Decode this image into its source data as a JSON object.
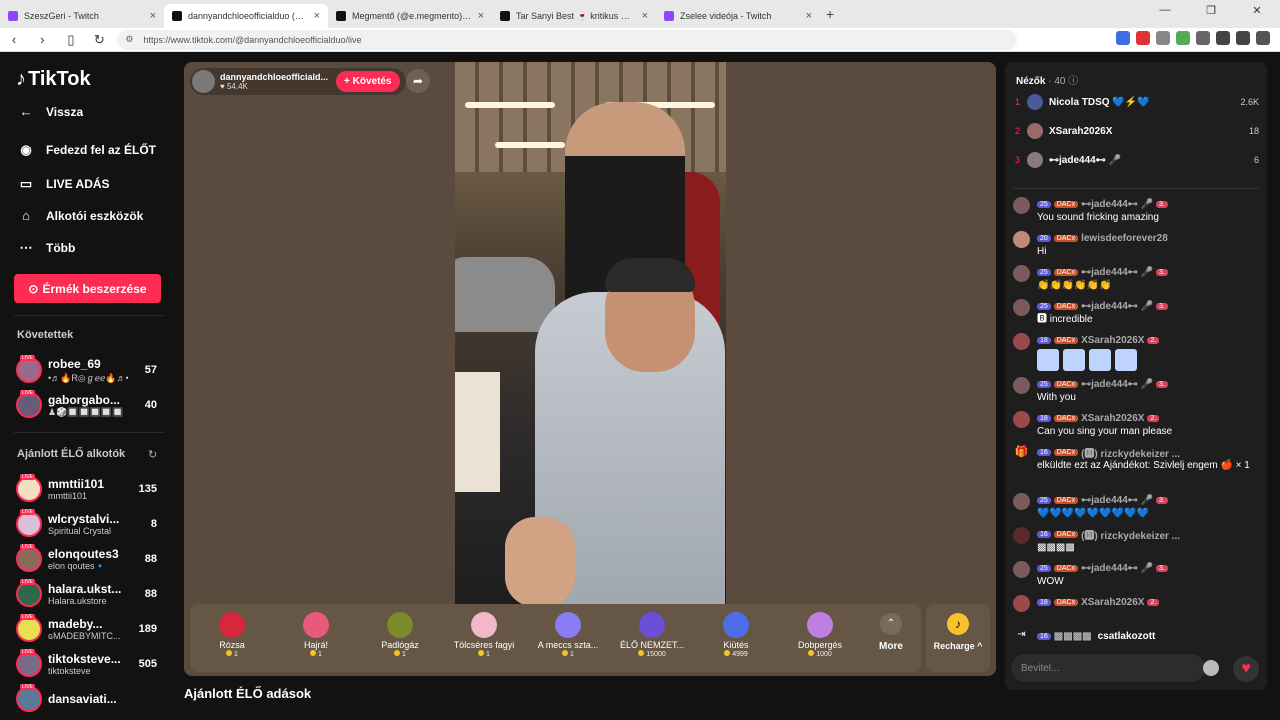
{
  "browser": {
    "tabs": [
      {
        "title": "SzeszGeri - Twitch",
        "color": "#9146ff"
      },
      {
        "title": "dannyandchloeofficialduo (@da…",
        "color": "#111111"
      },
      {
        "title": "Megmentő (@e.megmento) ÉLŐ adá…",
        "color": "#111111"
      },
      {
        "title": "Tar Sanyi Best 🍷 kritikus 🎒 (@szop…",
        "color": "#111111"
      },
      {
        "title": "Zselee videója - Twitch",
        "color": "#9146ff"
      }
    ],
    "url": "https://www.tiktok.com/@dannyandchloeofficialduo/live"
  },
  "sidebar": {
    "logo": "TikTok",
    "nav": [
      {
        "label": "Vissza",
        "icon": "back-arrow-icon",
        "glyph": "←"
      },
      {
        "label": "Fedezd fel az ÉLŐT",
        "icon": "explore-live-icon",
        "glyph": "◉"
      },
      {
        "label": "LIVE ADÁS",
        "icon": "live-camera-icon",
        "glyph": "▭"
      },
      {
        "label": "Alkotói eszközök",
        "icon": "creator-tools-icon",
        "glyph": "⌂"
      },
      {
        "label": "Több",
        "icon": "more-dots-icon",
        "glyph": "⋯"
      }
    ],
    "coins_button": "Érmék beszerzése",
    "following_title": "Követettek",
    "following": [
      {
        "name": "robee_69",
        "sub": "•♬🔥R◎ℊℯℯ🔥♬•",
        "count": "57"
      },
      {
        "name": "gaborgabo...",
        "sub": "♟🎲🔲🔲🔲🔲🔲",
        "count": "40"
      }
    ],
    "suggested_title": "Ajánlott ÉLŐ alkotók",
    "suggested": [
      {
        "name": "mmttii101",
        "sub": "mmttii101",
        "count": "135"
      },
      {
        "name": "wlcrystalvi...",
        "sub": "Spiritual Crystal",
        "count": "8"
      },
      {
        "name": "elonqoutes3",
        "sub": "elon qoutes🔹",
        "count": "88"
      },
      {
        "name": "halara.ukst...",
        "sub": "Halara.ukstore",
        "count": "88"
      },
      {
        "name": "madeby...",
        "sub": "ɢMADEBYMITC...",
        "count": "189"
      },
      {
        "name": "tiktoksteve...",
        "sub": "tiktoksteve",
        "count": "505"
      },
      {
        "name": "dansaviati...",
        "sub": "",
        "count": ""
      }
    ]
  },
  "stream": {
    "host_name": "dannyandchloeofficiald...",
    "likes": "♥ 54.4K",
    "follow_label": "+ Követés",
    "gifts": [
      {
        "name": "Rózsa",
        "price": "1",
        "color": "#d8263a"
      },
      {
        "name": "Hajrá!",
        "price": "1",
        "color": "#e85a7b"
      },
      {
        "name": "Padlógáz",
        "price": "1",
        "color": "#7b8b2a"
      },
      {
        "name": "Tölcséres fagyi",
        "price": "1",
        "color": "#f2b8c8"
      },
      {
        "name": "A meccs szta...",
        "price": "1",
        "color": "#8a7cf5"
      },
      {
        "name": "ÉLŐ NEMZET...",
        "price": "15000",
        "color": "#6b4fd6"
      },
      {
        "name": "Kiütés",
        "price": "4999",
        "color": "#4d6ee8"
      },
      {
        "name": "Dobpergés",
        "price": "1000",
        "color": "#c07ee0"
      }
    ],
    "more_label": "More",
    "recharge_label": "Recharge ^",
    "recommended_title": "Ajánlott ÉLŐ adások"
  },
  "chat": {
    "viewers_label": "Nézők",
    "viewers_count": "· 40",
    "top_viewers": [
      {
        "rank": "1",
        "name": "Nicola TDSQ 💙⚡💙",
        "count": "2.6K"
      },
      {
        "rank": "2",
        "name": "XSarah2026X",
        "count": "18"
      },
      {
        "rank": "3",
        "name": "⊷jade444⊷ 🎤",
        "count": "6"
      }
    ],
    "messages": [
      {
        "lvl": "25",
        "badge": "DACx",
        "user": "⊷jade444⊷ 🎤",
        "rank": "3.",
        "text": "You sound fricking amazing"
      },
      {
        "lvl": "20",
        "badge": "DACx",
        "user": "lewisdeeforever28",
        "rank": "",
        "text": "Hi"
      },
      {
        "lvl": "25",
        "badge": "DACx",
        "user": "⊷jade444⊷ 🎤",
        "rank": "3.",
        "text": "👏👏👏👏👏👏"
      },
      {
        "lvl": "25",
        "badge": "DACx",
        "user": "⊷jade444⊷ 🎤",
        "rank": "3.",
        "text": "🅱 incredible"
      },
      {
        "lvl": "18",
        "badge": "DACx",
        "user": "XSarah2026X",
        "rank": "2.",
        "text": ""
      },
      {
        "lvl": "25",
        "badge": "DACx",
        "user": "⊷jade444⊷ 🎤",
        "rank": "3.",
        "text": "With you"
      },
      {
        "lvl": "18",
        "badge": "DACx",
        "user": "XSarah2026X",
        "rank": "2.",
        "text": "Can you sing your man please"
      },
      {
        "lvl": "16",
        "badge": "DACx",
        "user": "(🅼) rizckydekeizer ...",
        "rank": "",
        "text": "elküldte ezt az Ajándékot: Szivlelj engem 🍎 × 1"
      },
      {
        "lvl": "25",
        "badge": "DACx",
        "user": "⊷jade444⊷ 🎤",
        "rank": "3.",
        "text": "💙💙💙💙💙💙💙💙💙"
      },
      {
        "lvl": "16",
        "badge": "DACx",
        "user": "(🅼) rizckydekeizer ...",
        "rank": "",
        "text": "▩▩▩▩"
      },
      {
        "lvl": "25",
        "badge": "DACx",
        "user": "⊷jade444⊷ 🎤",
        "rank": "3.",
        "text": "WOW"
      },
      {
        "lvl": "18",
        "badge": "DACx",
        "user": "XSarah2026X",
        "rank": "2.",
        "text": ""
      }
    ],
    "join": {
      "lvl": "16",
      "user": "▩▩▩▩",
      "text": "csatlakozott"
    },
    "input_placeholder": "Bevitel..."
  }
}
